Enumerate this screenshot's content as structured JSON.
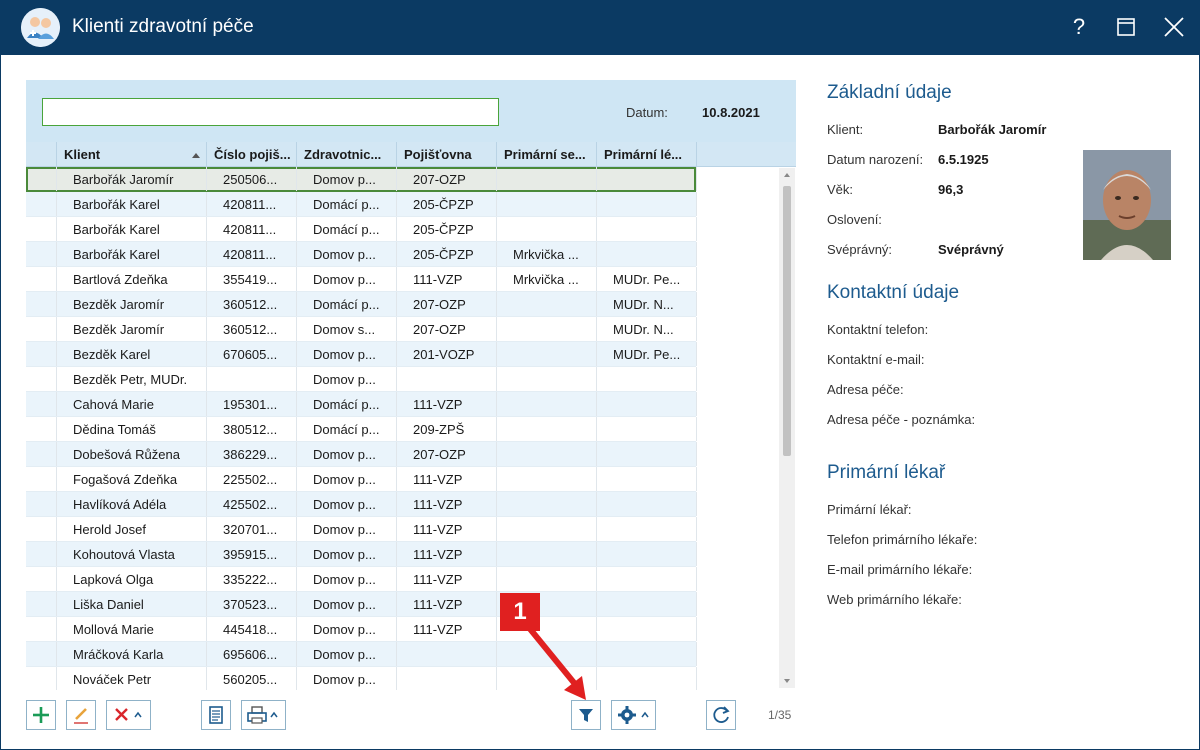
{
  "window": {
    "title": "Klienti zdravotní péče",
    "help_glyph": "?"
  },
  "filter": {
    "search_value": "",
    "date_label": "Datum:",
    "date_value": "10.8.2021"
  },
  "grid": {
    "columns": [
      "Klient",
      "Číslo pojiš...",
      "Zdravotnic...",
      "Pojišťovna",
      "Primární se...",
      "Primární lé..."
    ],
    "rows": [
      [
        "Barbořák Jaromír",
        "250506...",
        "Domov p...",
        "207-OZP",
        "",
        ""
      ],
      [
        "Barbořák Karel",
        "420811...",
        "Domácí p...",
        "205-ČPZP",
        "",
        ""
      ],
      [
        "Barbořák Karel",
        "420811...",
        "Domácí p...",
        "205-ČPZP",
        "",
        ""
      ],
      [
        "Barbořák Karel",
        "420811...",
        "Domov p...",
        "205-ČPZP",
        "Mrkvička ...",
        ""
      ],
      [
        "Bartlová Zdeňka",
        "355419...",
        "Domov p...",
        "111-VZP",
        "Mrkvička ...",
        "MUDr. Pe..."
      ],
      [
        "Bezděk Jaromír",
        "360512...",
        "Domácí p...",
        "207-OZP",
        "",
        "MUDr. N..."
      ],
      [
        "Bezděk Jaromír",
        "360512...",
        "Domov s...",
        "207-OZP",
        "",
        "MUDr. N..."
      ],
      [
        "Bezděk Karel",
        "670605...",
        "Domov p...",
        "201-VOZP",
        "",
        "MUDr. Pe..."
      ],
      [
        "Bezděk Petr, MUDr.",
        "",
        "Domov p...",
        "",
        "",
        ""
      ],
      [
        "Cahová Marie",
        "195301...",
        "Domácí p...",
        "111-VZP",
        "",
        ""
      ],
      [
        "Dědina Tomáš",
        "380512...",
        "Domácí p...",
        "209-ZPŠ",
        "",
        ""
      ],
      [
        "Dobešová Růžena",
        "386229...",
        "Domov p...",
        "207-OZP",
        "",
        ""
      ],
      [
        "Fogašová Zdeňka",
        "225502...",
        "Domov p...",
        "111-VZP",
        "",
        ""
      ],
      [
        "Havlíková Adéla",
        "425502...",
        "Domov p...",
        "111-VZP",
        "",
        ""
      ],
      [
        "Herold Josef",
        "320701...",
        "Domov p...",
        "111-VZP",
        "",
        ""
      ],
      [
        "Kohoutová Vlasta",
        "395915...",
        "Domov p...",
        "111-VZP",
        "",
        ""
      ],
      [
        "Lapková Olga",
        "335222...",
        "Domov p...",
        "111-VZP",
        "",
        ""
      ],
      [
        "Liška Daniel",
        "370523...",
        "Domov p...",
        "111-VZP",
        "",
        ""
      ],
      [
        "Mollová Marie",
        "445418...",
        "Domov p...",
        "111-VZP",
        "",
        ""
      ],
      [
        "Mráčková Karla",
        "695606...",
        "Domov p...",
        "",
        "",
        ""
      ],
      [
        "Nováček Petr",
        "560205...",
        "Domov p...",
        "",
        "",
        ""
      ]
    ],
    "selected_row": 0,
    "page_count": "1/35"
  },
  "toolbar": {
    "icons": [
      "add-icon",
      "edit-icon",
      "delete-icon",
      "document-icon",
      "print-icon",
      "filter-icon",
      "settings-icon",
      "refresh-icon"
    ]
  },
  "annotation": {
    "badge": "1",
    "color": "#e02020"
  },
  "details": {
    "basic": {
      "title": "Základní údaje",
      "fields": [
        {
          "label": "Klient:",
          "value": "Barbořák Jaromír"
        },
        {
          "label": "Datum narození:",
          "value": "6.5.1925"
        },
        {
          "label": "Věk:",
          "value": "96,3"
        },
        {
          "label": "Oslovení:",
          "value": ""
        },
        {
          "label": "Svéprávný:",
          "value": "Svéprávný"
        }
      ]
    },
    "contact": {
      "title": "Kontaktní údaje",
      "fields": [
        {
          "label": "Kontaktní telefon:",
          "value": ""
        },
        {
          "label": "Kontaktní e-mail:",
          "value": ""
        },
        {
          "label": "Adresa péče:",
          "value": ""
        },
        {
          "label": "Adresa péče - poznámka:",
          "value": ""
        }
      ]
    },
    "doctor": {
      "title": "Primární lékař",
      "fields": [
        {
          "label": "Primární lékař:",
          "value": ""
        },
        {
          "label": "Telefon primárního lékaře:",
          "value": ""
        },
        {
          "label": "E-mail primárního lékaře:",
          "value": ""
        },
        {
          "label": "Web primárního lékaře:",
          "value": ""
        }
      ]
    }
  },
  "colors": {
    "titlebar": "#0b3a63",
    "accent": "#1d5b8e",
    "header_bg": "#cfe6f4",
    "selection_border": "#4a8a3a"
  }
}
